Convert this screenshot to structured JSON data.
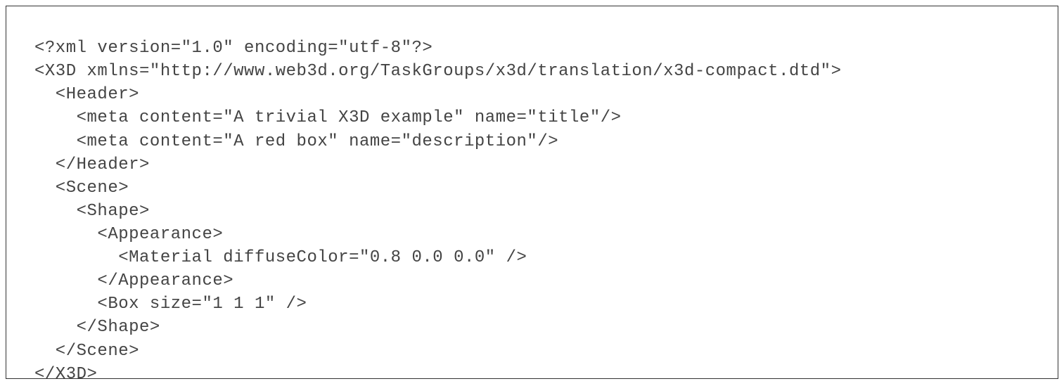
{
  "code": {
    "lines": [
      "<?xml version=\"1.0\" encoding=\"utf-8\"?>",
      "<X3D xmlns=\"http://www.web3d.org/TaskGroups/x3d/translation/x3d-compact.dtd\">",
      "  <Header>",
      "    <meta content=\"A trivial X3D example\" name=\"title\"/>",
      "    <meta content=\"A red box\" name=\"description\"/>",
      "  </Header>",
      "  <Scene>",
      "    <Shape>",
      "      <Appearance>",
      "        <Material diffuseColor=\"0.8 0.0 0.0\" />",
      "      </Appearance>",
      "      <Box size=\"1 1 1\" />",
      "    </Shape>",
      "  </Scene>",
      "</X3D>"
    ]
  }
}
